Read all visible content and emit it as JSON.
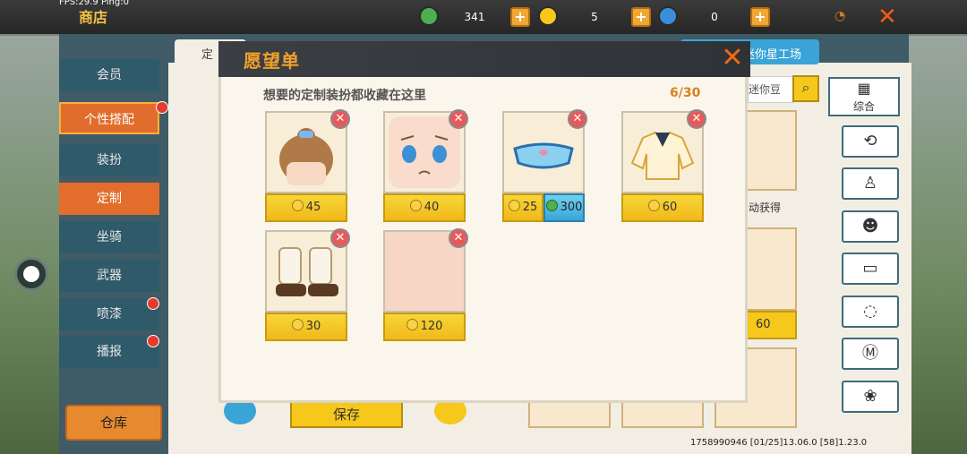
{
  "topbar": {
    "fps_text": "FPS:29.9  Ping:0",
    "shop_title": "商店",
    "currency": [
      {
        "icon": "green-gem-icon",
        "value": "341",
        "color": "#4caf50"
      },
      {
        "icon": "gold-coin-icon",
        "value": "5",
        "color": "#f5c81b"
      },
      {
        "icon": "blue-star-coin-icon",
        "value": "0",
        "color": "#3a8fd8"
      }
    ],
    "plus_label": "+",
    "close_label": "✕"
  },
  "left_nav": {
    "items": [
      {
        "label": "会员"
      },
      {
        "label": "个性搭配"
      },
      {
        "label": "装扮"
      },
      {
        "label": "定制"
      },
      {
        "label": "坐骑"
      },
      {
        "label": "武器"
      },
      {
        "label": "喷漆"
      },
      {
        "label": "播报"
      }
    ],
    "warehouse_label": "仓库"
  },
  "background": {
    "tab_left": "定",
    "tab_right": "迷你星工场",
    "search_text": "迷你豆",
    "category_all": "综合",
    "unlock_text": "动获得",
    "bg_price": "60",
    "save_label": "保存",
    "bottom_info": "1758990946   [01/25]13.06.0   [58]1.23.0"
  },
  "wishlist": {
    "title": "愿望单",
    "subtitle": "想要的定制装扮都收藏在这里",
    "count": "6/30",
    "close_label": "✕",
    "remove_label": "✕",
    "items": [
      {
        "name": "bun-hairstyle-icon",
        "price": "45"
      },
      {
        "name": "worried-face-icon",
        "price": "40"
      },
      {
        "name": "face-mask-icon",
        "price": "25",
        "diamond_price": "300"
      },
      {
        "name": "sailor-jacket-icon",
        "price": "60"
      },
      {
        "name": "fur-boots-icon",
        "price": "30"
      },
      {
        "name": "blank-skin-icon",
        "price": "120"
      }
    ]
  }
}
